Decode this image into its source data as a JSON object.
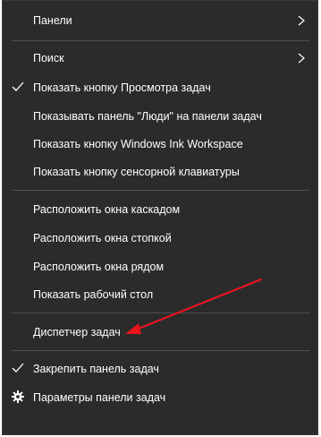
{
  "menu": {
    "items": [
      {
        "label": "Панели",
        "has_submenu": true,
        "checked": false,
        "icon": null
      },
      {
        "label": "Поиск",
        "has_submenu": true,
        "checked": false,
        "icon": null
      },
      {
        "label": "Показать кнопку Просмотра задач",
        "has_submenu": false,
        "checked": true,
        "icon": "checkmark-icon"
      },
      {
        "label": "Показывать панель \"Люди\" на панели задач",
        "has_submenu": false,
        "checked": false,
        "icon": null
      },
      {
        "label": "Показать кнопку Windows Ink Workspace",
        "has_submenu": false,
        "checked": false,
        "icon": null
      },
      {
        "label": "Показать кнопку сенсорной клавиатуры",
        "has_submenu": false,
        "checked": false,
        "icon": null
      },
      {
        "label": "Расположить окна каскадом",
        "has_submenu": false,
        "checked": false,
        "icon": null
      },
      {
        "label": "Расположить окна стопкой",
        "has_submenu": false,
        "checked": false,
        "icon": null
      },
      {
        "label": "Расположить окна рядом",
        "has_submenu": false,
        "checked": false,
        "icon": null
      },
      {
        "label": "Показать рабочий стол",
        "has_submenu": false,
        "checked": false,
        "icon": null
      },
      {
        "label": "Диспетчер задач",
        "has_submenu": false,
        "checked": false,
        "icon": null
      },
      {
        "label": "Закрепить панель задач",
        "has_submenu": false,
        "checked": true,
        "icon": "checkmark-icon"
      },
      {
        "label": "Параметры панели задач",
        "has_submenu": false,
        "checked": false,
        "icon": "gear-icon"
      }
    ]
  },
  "colors": {
    "menu_background": "#2b2b2b",
    "text": "#ffffff",
    "separator": "#505050",
    "annotation_arrow": "#e8141e"
  },
  "annotation": {
    "type": "arrow",
    "points_to": "Диспетчер задач"
  }
}
